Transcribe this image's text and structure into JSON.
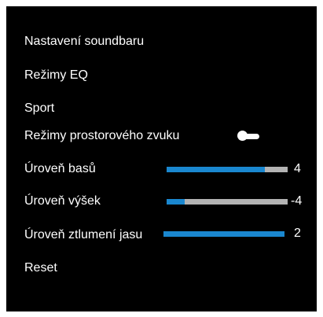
{
  "menu": {
    "items": [
      {
        "label": "Nastavení soundbaru"
      },
      {
        "label": "Režimy EQ"
      },
      {
        "label": "Sport"
      },
      {
        "label": "Režimy prostorového zvuku",
        "toggle": {
          "state": "off"
        }
      },
      {
        "label": "Úroveň basů",
        "slider": {
          "value": "4",
          "fill_fraction": 0.81
        }
      },
      {
        "label": "Úroveň výšek",
        "slider": {
          "value": "-4",
          "fill_fraction": 0.15
        }
      },
      {
        "label": "Úroveň ztlumení jasu",
        "slider": {
          "value": "2",
          "fill_fraction": 1.0
        }
      },
      {
        "label": "Reset"
      }
    ]
  },
  "colors": {
    "background": "#000000",
    "text": "#ffffff",
    "slider_fill": "#1a87cf",
    "slider_track": "#b3b3b3"
  }
}
